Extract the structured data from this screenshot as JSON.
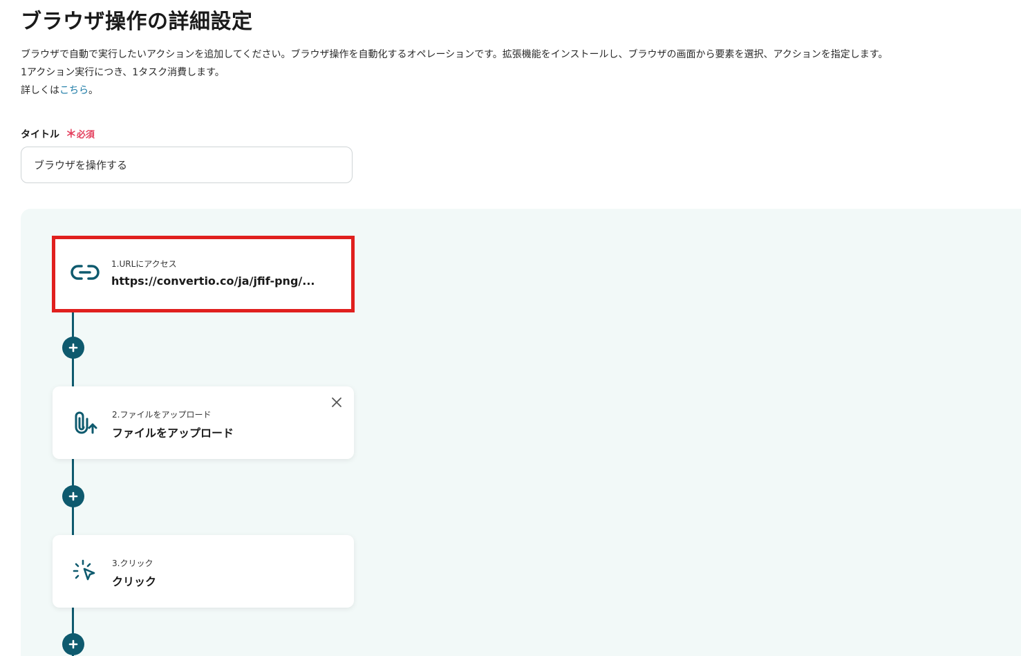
{
  "page": {
    "title": "ブラウザ操作の詳細設定",
    "description_line1": "ブラウザで自動で実行したいアクションを追加してください。ブラウザ操作を自動化するオペレーションです。拡張機能をインストールし、ブラウザの画面から要素を選択、アクションを指定します。",
    "description_line2": "1アクション実行につき、1タスク消費します。",
    "details_prefix": "詳しくは",
    "details_link": "こちら",
    "details_suffix": "。"
  },
  "form": {
    "title_label": "タイトル",
    "required_star": "＊",
    "required_text": "必須",
    "title_value": "ブラウザを操作する"
  },
  "actions": [
    {
      "step": "1.URLにアクセス",
      "label": "https://convertio.co/ja/jfif-png/...",
      "icon": "link-icon",
      "selected": true
    },
    {
      "step": "2.ファイルをアップロード",
      "label": "ファイルをアップロード",
      "icon": "paperclip-upload-icon",
      "closable": true
    },
    {
      "step": "3.クリック",
      "label": "クリック",
      "icon": "cursor-click-icon"
    }
  ],
  "colors": {
    "accent": "#0e5a6e",
    "canvas_bg": "#f2f9f8",
    "required": "#e4405e",
    "highlight": "#e0201e",
    "link": "#1b7aa6"
  }
}
